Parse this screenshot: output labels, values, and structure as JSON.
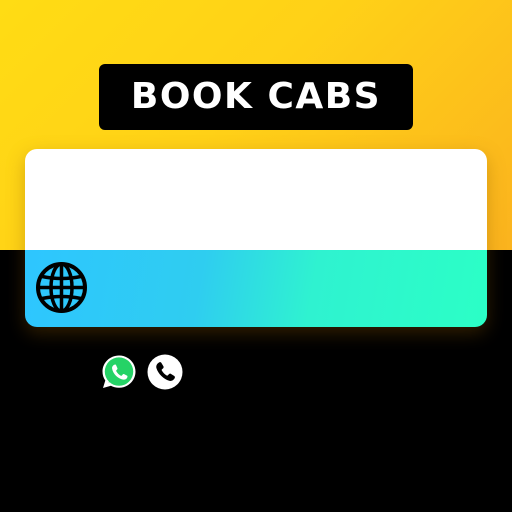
{
  "header": {
    "title": "BOOK CABS"
  },
  "icons": {
    "globe": "globe-icon",
    "whatsapp": "whatsapp-icon",
    "phone": "phone-icon"
  },
  "colors": {
    "brand_yellow": "#ffd117",
    "badge_black": "#000000",
    "card_white": "#ffffff",
    "gradient_blue": "#2ec6ff",
    "gradient_green": "#2bffc6",
    "whatsapp_green": "#25d366"
  }
}
